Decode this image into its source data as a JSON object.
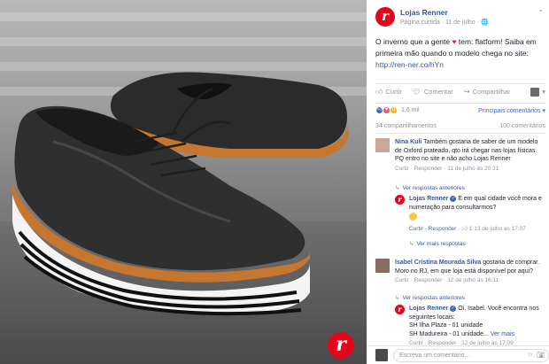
{
  "post": {
    "page_name": "Lojas Renner",
    "meta": "Página curtida · 11 de julho ·",
    "text_before": "O inverno que a gente ",
    "text_after": " tem: flatform! Saiba em primeira mão quando o modelo chega no site:",
    "link": "http://ren-ner.co/hYn",
    "brand_mark": "r"
  },
  "actions": {
    "like": "Curtir",
    "comment": "Comentar",
    "share": "Compartilhar",
    "like_icon": "thumbs-up-icon",
    "comment_icon": "comment-icon",
    "share_icon": "share-icon"
  },
  "stats": {
    "reaction_count": "1,6 mil",
    "sort_label": "Principais comentários ▾",
    "shares": "34 compartilhamentos",
    "comments": "100 comentários"
  },
  "comments": [
    {
      "name": "Nina Kuli",
      "text": "Também gostaria de saber de um modelo de Oxford prateado, qto irá chegar nas lojas físicas. PQ entro no site e não acho Lojas Renner",
      "reply": "Curtir · Responder · 11 de julho às 20:21",
      "more_replies": "Ver respostas anteriores",
      "page_reply": {
        "name": "Lojas Renner",
        "text": "E em qual cidade você mora e numeração para consultarmos?",
        "meta_links": "Curtir · Responder ·",
        "meta_like": "1",
        "meta_time": "13 de julho às 17:07",
        "more": "Ver mais respostas"
      }
    },
    {
      "name": "Isabel Cristina Mourada Silva",
      "text": "gostaria de comprar. Moro no RJ, em que loja está disponível por aqui?",
      "reply": "Curtir · Responder · 12 de julho às 16:11",
      "more_replies": "Ver respostas anteriores",
      "page_reply": {
        "name": "Lojas Renner",
        "text": "Oi, Isabel. Você encontra nos seguintes locais:",
        "line1": "SH Ilha Plaza - 01 unidade",
        "line2": "SH Madureira - 01 unidade...",
        "see_more": "Ver mais",
        "meta": "Curtir · Responder · 12 de julho às 17:09"
      }
    }
  ],
  "composer": {
    "placeholder": "Escreva um comentário..."
  },
  "colors": {
    "brand": "#e3051b",
    "link": "#365899",
    "muted": "#90949c"
  }
}
